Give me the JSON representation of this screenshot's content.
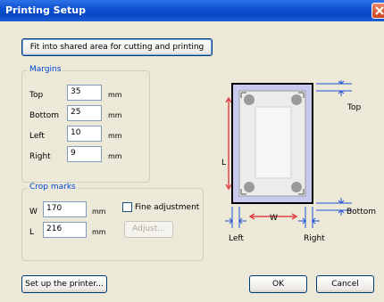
{
  "window": {
    "title": "Printing Setup"
  },
  "buttons": {
    "fit": "Fit into shared area for cutting and printing",
    "setup_printer": "Set up the printer...",
    "ok": "OK",
    "cancel": "Cancel",
    "adjust": "Adjust..."
  },
  "margins": {
    "label": "Margins",
    "unit": "mm",
    "fields": [
      {
        "label": "Top",
        "value": "35"
      },
      {
        "label": "Bottom",
        "value": "25"
      },
      {
        "label": "Left",
        "value": "10"
      },
      {
        "label": "Right",
        "value": "9"
      }
    ]
  },
  "crop_marks": {
    "label": "Crop marks",
    "unit": "mm",
    "w_label": "W",
    "w_value": "170",
    "l_label": "L",
    "l_value": "216",
    "fine_adjustment_label": "Fine adjustment",
    "fine_adjustment_checked": false
  },
  "preview": {
    "top_label": "Top",
    "bottom_label": "Bottom",
    "left_label": "Left",
    "right_label": "Right",
    "w_label": "W",
    "l_label": "L"
  },
  "colors": {
    "accent": "#0046d5",
    "margin_fill": "#c9c9f0",
    "dimension": "#e0202a",
    "marker": "#1c4fd6"
  }
}
